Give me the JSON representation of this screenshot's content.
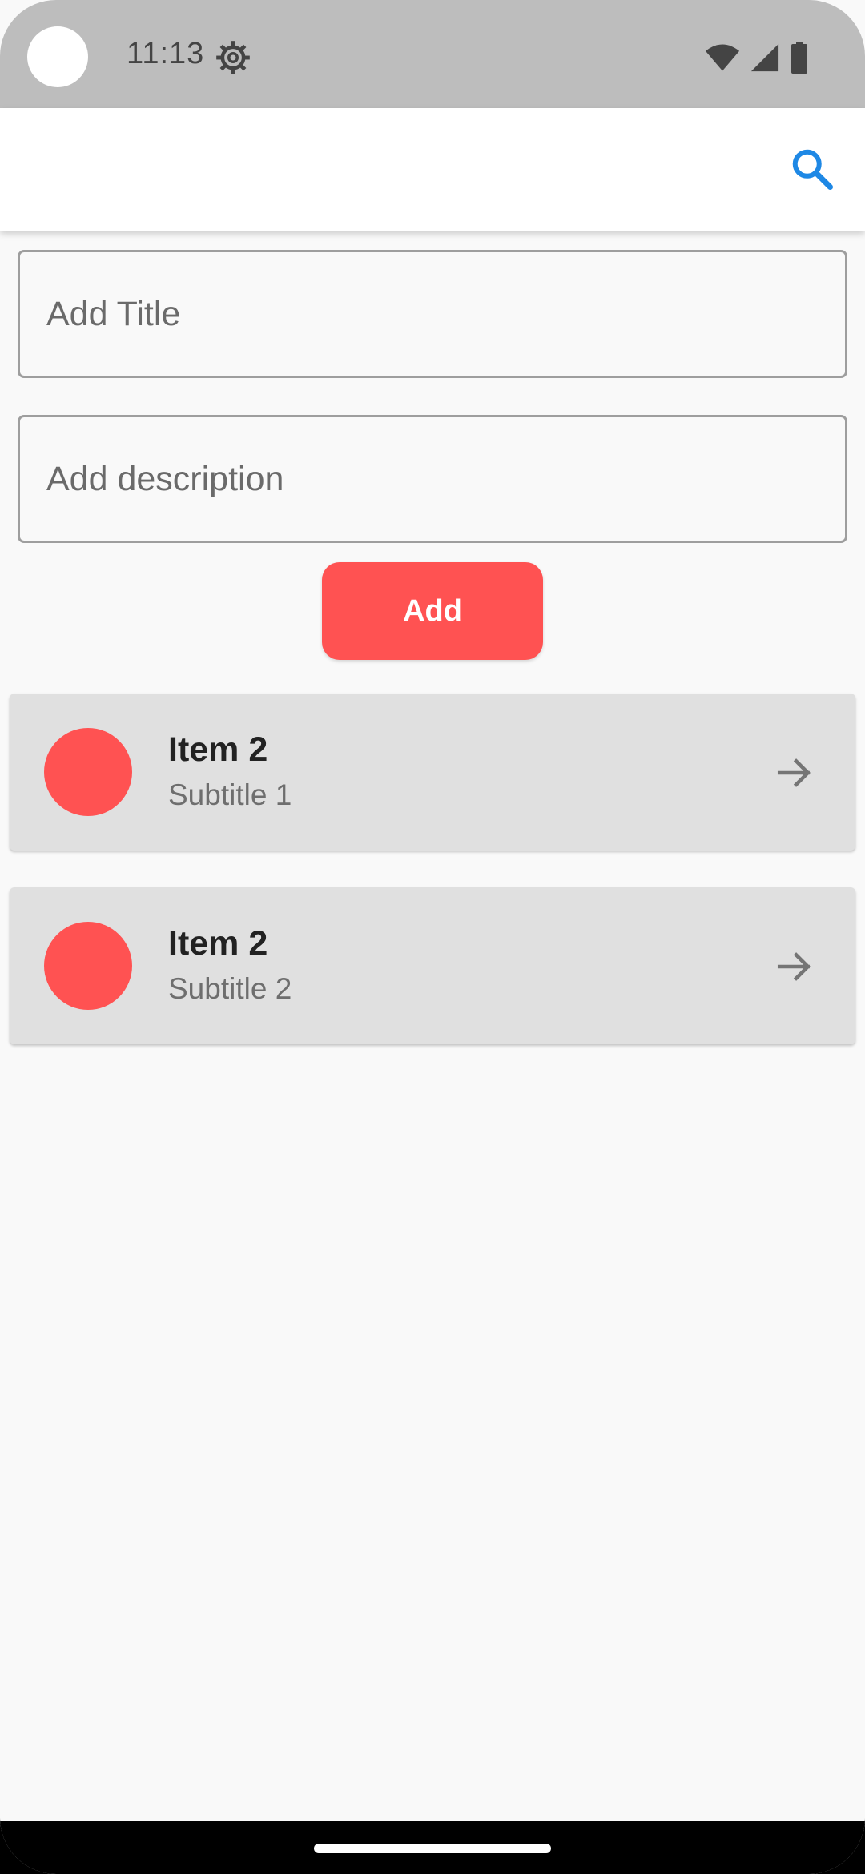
{
  "status_bar": {
    "time": "11:13",
    "icons": [
      "settings-icon",
      "wifi-icon",
      "signal-icon",
      "battery-icon"
    ]
  },
  "app_bar": {
    "search_icon": "search-icon",
    "accent_color": "#1e88e5"
  },
  "form": {
    "title_placeholder": "Add Title",
    "title_value": "",
    "description_placeholder": "Add description",
    "description_value": "",
    "add_label": "Add",
    "button_color": "#ff5252"
  },
  "items": [
    {
      "title": "Item 2",
      "subtitle": "Subtitle 1",
      "avatar_color": "#ff5252",
      "trailing_icon": "arrow-forward-icon"
    },
    {
      "title": "Item 2",
      "subtitle": "Subtitle 2",
      "avatar_color": "#ff5252",
      "trailing_icon": "arrow-forward-icon"
    }
  ]
}
